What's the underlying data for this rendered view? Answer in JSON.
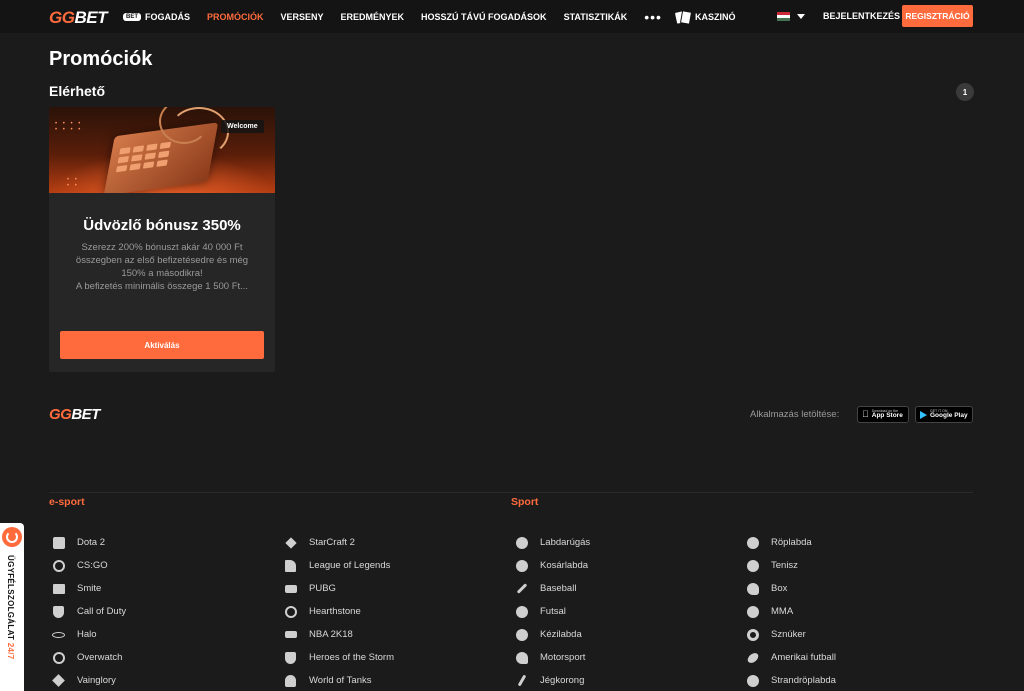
{
  "header": {
    "logo_gg": "GG",
    "logo_bet": "BET",
    "bet_badge": "BET",
    "nav": [
      {
        "label": "FOGADÁS"
      },
      {
        "label": "PROMÓCIÓK"
      },
      {
        "label": "VERSENY"
      },
      {
        "label": "EREDMÉNYEK"
      },
      {
        "label": "HOSSZÚ TÁVÚ FOGADÁSOK"
      },
      {
        "label": "STATISZTIKÁK"
      },
      {
        "label": "KASZINÓ"
      }
    ],
    "more": "•••",
    "login": "BEJELENTKEZÉS",
    "register": "REGISZTRÁCIÓ",
    "flag_colors": [
      "#ce2939",
      "#ffffff",
      "#477050"
    ]
  },
  "page": {
    "title": "Promóciók",
    "section": "Elérhető",
    "count": "1"
  },
  "promo": {
    "tag": "Welcome",
    "title": "Üdvözlő bónusz 350%",
    "description": "Szerezz 200% bónuszt akár 40 000 Ft\nösszegben az első befizetésedre és még\n150% a másodikra!\nA befizetés minimális összege 1 500 Ft...",
    "button": "Aktiválás"
  },
  "footer": {
    "logo_gg": "GG",
    "logo_bet": "BET",
    "app_label": "Alkalmazás letöltése:",
    "appstore_small": "Download on the",
    "appstore_big": "App Store",
    "googleplay_small": "GET IT ON",
    "googleplay_big": "Google Play",
    "esport_title": "e-sport",
    "sport_title": "Sport",
    "esport_col1": [
      {
        "label": "Dota 2",
        "icon": "dota2-icon"
      },
      {
        "label": "CS:GO",
        "icon": "csgo-icon"
      },
      {
        "label": "Smite",
        "icon": "smite-icon"
      },
      {
        "label": "Call of Duty",
        "icon": "callofduty-icon"
      },
      {
        "label": "Halo",
        "icon": "halo-icon"
      },
      {
        "label": "Overwatch",
        "icon": "overwatch-icon"
      },
      {
        "label": "Vainglory",
        "icon": "vainglory-icon"
      }
    ],
    "esport_col2": [
      {
        "label": "StarCraft 2",
        "icon": "starcraft-icon"
      },
      {
        "label": "League of Legends",
        "icon": "lol-icon"
      },
      {
        "label": "PUBG",
        "icon": "pubg-icon"
      },
      {
        "label": "Hearthstone",
        "icon": "hearthstone-icon"
      },
      {
        "label": "NBA 2K18",
        "icon": "nba2k-icon"
      },
      {
        "label": "Heroes of the Storm",
        "icon": "heroes-icon"
      },
      {
        "label": "World of Tanks",
        "icon": "wot-icon"
      }
    ],
    "sport_col1": [
      {
        "label": "Labdarúgás",
        "icon": "soccer-ball-icon"
      },
      {
        "label": "Kosárlabda",
        "icon": "basketball-icon"
      },
      {
        "label": "Baseball",
        "icon": "baseball-icon"
      },
      {
        "label": "Futsal",
        "icon": "futsal-icon"
      },
      {
        "label": "Kézilabda",
        "icon": "handball-icon"
      },
      {
        "label": "Motorsport",
        "icon": "helmet-icon"
      },
      {
        "label": "Jégkorong",
        "icon": "hockey-icon"
      }
    ],
    "sport_col2": [
      {
        "label": "Röplabda",
        "icon": "volleyball-icon"
      },
      {
        "label": "Tenisz",
        "icon": "tennis-icon"
      },
      {
        "label": "Box",
        "icon": "boxing-glove-icon"
      },
      {
        "label": "MMA",
        "icon": "mma-icon"
      },
      {
        "label": "Sznúker",
        "icon": "snooker-icon"
      },
      {
        "label": "Amerikai futball",
        "icon": "american-football-icon"
      },
      {
        "label": "Strandröplabda",
        "icon": "beach-volleyball-icon"
      }
    ]
  },
  "support": {
    "text": "ÜGYFÉLSZOLGÁLAT",
    "hours": "24/7"
  }
}
